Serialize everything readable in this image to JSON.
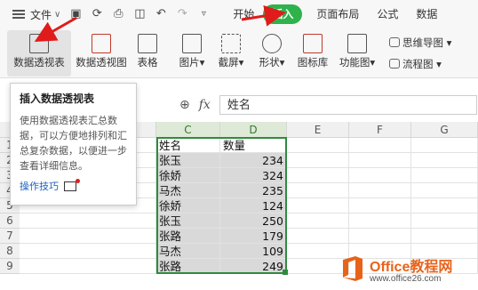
{
  "menu": {
    "file": "文件",
    "tabs": [
      "开始",
      "插入",
      "页面布局",
      "公式",
      "数据"
    ],
    "active_tab": "插入",
    "active_color": "#2eb24b"
  },
  "ribbon": {
    "pivot_table": "数据透视表",
    "pivot_chart": "数据透视图",
    "table": "表格",
    "picture": "图片",
    "screenshot": "截屏",
    "shape": "形状",
    "icon_lib": "图标库",
    "func_chart": "功能图",
    "mind_map": "思维导图",
    "flow_chart": "流程图"
  },
  "formula_bar": {
    "fx": "fx",
    "value": "姓名"
  },
  "tooltip": {
    "title": "插入数据透视表",
    "desc": "使用数据透视表汇总数据，可以方便地排列和汇总复杂数据，以便进一步查看详细信息。",
    "link": "操作技巧"
  },
  "columns": [
    "C",
    "D",
    "E",
    "F",
    "G"
  ],
  "rows": [
    "1",
    "2",
    "3",
    "4",
    "5",
    "6",
    "7",
    "8",
    "9"
  ],
  "sheet": {
    "header": [
      "姓名",
      "数量"
    ],
    "data": [
      [
        "张玉",
        "234"
      ],
      [
        "徐娇",
        "324"
      ],
      [
        "马杰",
        "235"
      ],
      [
        "徐娇",
        "124"
      ],
      [
        "张玉",
        "250"
      ],
      [
        "张路",
        "179"
      ],
      [
        "马杰",
        "109"
      ],
      [
        "张路",
        "249"
      ]
    ]
  },
  "watermark": {
    "brand": "Office教程网",
    "url": "www.office26.com"
  }
}
